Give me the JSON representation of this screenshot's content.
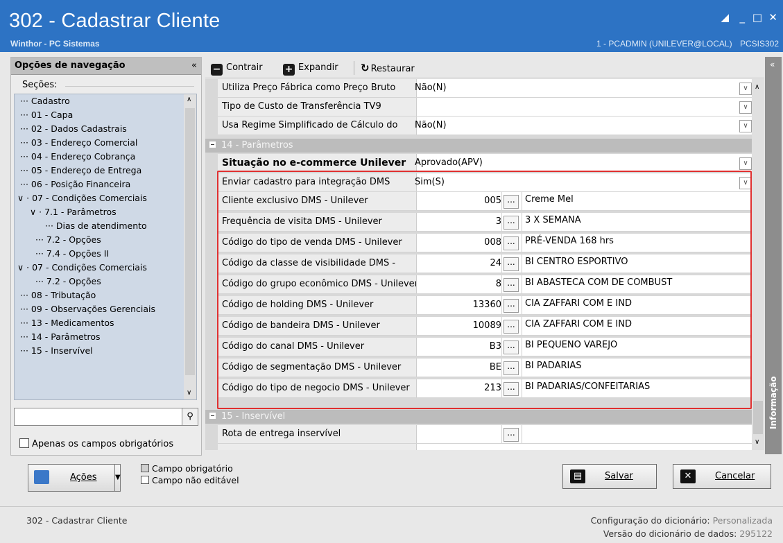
{
  "window": {
    "title": "302 - Cadastrar Cliente",
    "subtitle": "Winthor - PC Sistemas",
    "user": "1 - PCADMIN (UNILEVER@LOCAL)",
    "program": "PCSIS302"
  },
  "nav": {
    "header": "Opções de navegação",
    "collapse": "«",
    "sections_label": "Seções:",
    "items": [
      {
        "label": "Cadastro",
        "level": 0
      },
      {
        "label": "01 - Capa",
        "level": 0
      },
      {
        "label": "02 - Dados Cadastrais",
        "level": 0
      },
      {
        "label": "03 - Endereço Comercial",
        "level": 0
      },
      {
        "label": "04 - Endereço Cobrança",
        "level": 0
      },
      {
        "label": "05 - Endereço de Entrega",
        "level": 0
      },
      {
        "label": "06 - Posição Financeira",
        "level": 0
      },
      {
        "label": "07 - Condições Comerciais",
        "level": 0
      },
      {
        "label": "7.1 - Parâmetros",
        "level": 1
      },
      {
        "label": "Dias de atendimento",
        "level": 2
      },
      {
        "label": "7.2 - Opções",
        "level": 1
      },
      {
        "label": "7.4 - Opções II",
        "level": 1
      },
      {
        "label": "07 - Condições Comerciais",
        "level": 0
      },
      {
        "label": "7.2 - Opções",
        "level": 1
      },
      {
        "label": "08 - Tributação",
        "level": 0
      },
      {
        "label": "09 - Observações Gerenciais",
        "level": 0
      },
      {
        "label": "13 - Medicamentos",
        "level": 0
      },
      {
        "label": "14 - Parâmetros",
        "level": 0
      },
      {
        "label": "15 - Inservível",
        "level": 0
      }
    ],
    "search_value": "",
    "required_only_label": "Apenas os campos obrigatórios"
  },
  "toolbar": {
    "collapse_label": "Contrair",
    "expand_label": "Expandir",
    "restore_label": "Restaurar"
  },
  "grid": {
    "top_rows": [
      {
        "label": "Utiliza Preço Fábrica como Preço Bruto",
        "value": "Não(N)"
      },
      {
        "label": "Tipo de Custo de Transferência TV9",
        "value": ""
      },
      {
        "label": "Usa Regime Simplificado de Cálculo do",
        "value": "Não(N)"
      }
    ],
    "group14": "14 - Parâmetros",
    "ecommerce": {
      "label": "Situação no e-commerce Unilever",
      "value": "Aprovado(APV)"
    },
    "send_dms": {
      "label": "Enviar cadastro para integração DMS",
      "value": "Sim(S)"
    },
    "dms_rows": [
      {
        "label": "Cliente exclusivo DMS - Unilever",
        "code": "005",
        "desc": "Creme Mel"
      },
      {
        "label": "Frequência de visita DMS - Unilever",
        "code": "3",
        "desc": "3 X SEMANA"
      },
      {
        "label": "Código do tipo de venda DMS - Unilever",
        "code": "008",
        "desc": "PRÉ-VENDA 168 hrs"
      },
      {
        "label": "Código da classe de visibilidade DMS - ",
        "code": "24",
        "desc": "BI CENTRO ESPORTIVO"
      },
      {
        "label": "Código do grupo econômico DMS - Unilever",
        "code": "8",
        "desc": "BI ABASTECA COM DE COMBUST"
      },
      {
        "label": "Código de holding DMS - Unilever",
        "code": "13360",
        "desc": "CIA ZAFFARI COM E IND"
      },
      {
        "label": "Código de bandeira DMS - Unilever",
        "code": "10089",
        "desc": "CIA ZAFFARI COM E IND"
      },
      {
        "label": "Código do canal DMS - Unilever",
        "code": "B3",
        "desc": "BI PEQUENO VAREJO"
      },
      {
        "label": "Código de segmentação DMS - Unilever",
        "code": "BE",
        "desc": "BI PADARIAS"
      },
      {
        "label": "Código do tipo de negocio DMS - Unilever",
        "code": "213",
        "desc": "BI PADARIAS/CONFEITARIAS"
      }
    ],
    "group15": "15 - Inservível",
    "route_row": {
      "label": "Rota de entrega inservível",
      "code": "",
      "desc": ""
    }
  },
  "info_tab": "Informação",
  "bottom": {
    "actions_label": "Ações",
    "legend_required": "Campo obrigatório",
    "legend_readonly": "Campo não editável",
    "save_label": "Salvar",
    "cancel_label": "Cancelar"
  },
  "status": {
    "left": "302 - Cadastrar Cliente",
    "config_label": "Configuração do dicionário:",
    "config_value": "Personalizada",
    "version_label": "Versão do dicionário de dados:",
    "version_value": "295122"
  }
}
